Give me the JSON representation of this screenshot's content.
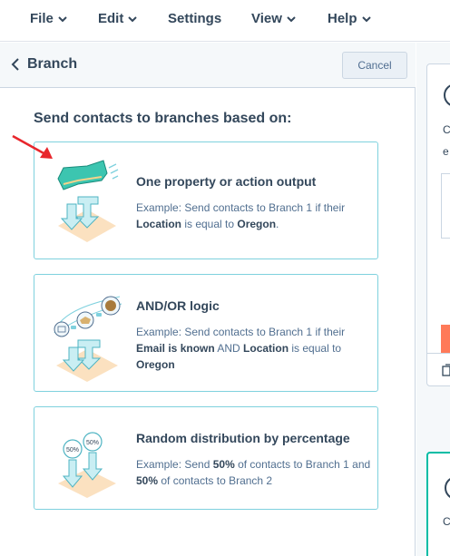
{
  "menu": [
    {
      "label": "File",
      "has_dropdown": true
    },
    {
      "label": "Edit",
      "has_dropdown": true
    },
    {
      "label": "Settings",
      "has_dropdown": false
    },
    {
      "label": "View",
      "has_dropdown": true
    },
    {
      "label": "Help",
      "has_dropdown": true
    }
  ],
  "panel": {
    "back_label": "Branch",
    "cancel_label": "Cancel",
    "heading": "Send contacts to branches based on:"
  },
  "options": [
    {
      "title": "One property or action output",
      "desc": [
        {
          "t": "Example: Send contacts to Branch 1 if their "
        },
        {
          "t": "Location",
          "b": true
        },
        {
          "t": " is equal to "
        },
        {
          "t": "Oregon",
          "b": true
        },
        {
          "t": "."
        }
      ]
    },
    {
      "title": "AND/OR logic",
      "desc": [
        {
          "t": "Example: Send contacts to Branch 1 if their "
        },
        {
          "t": "Email is known",
          "b": true
        },
        {
          "t": " AND "
        },
        {
          "t": "Location",
          "b": true
        },
        {
          "t": " is equal to "
        },
        {
          "t": "Oregon",
          "b": true
        }
      ]
    },
    {
      "title": "Random distribution by percentage",
      "desc": [
        {
          "t": "Example: Send "
        },
        {
          "t": "50%",
          "b": true
        },
        {
          "t": " of contacts to Branch 1 and "
        },
        {
          "t": "50%",
          "b": true
        },
        {
          "t": " of contacts to Branch 2"
        }
      ],
      "badges": [
        "50%",
        "50%"
      ]
    }
  ],
  "right_partial": {
    "letters": [
      "C",
      "e",
      "C"
    ]
  },
  "colors": {
    "text": "#33475b",
    "muted": "#516f90",
    "card_border": "#7fd1de",
    "teal": "#00bda5",
    "orange": "#ff7a59",
    "arrow": "#e8262c"
  }
}
